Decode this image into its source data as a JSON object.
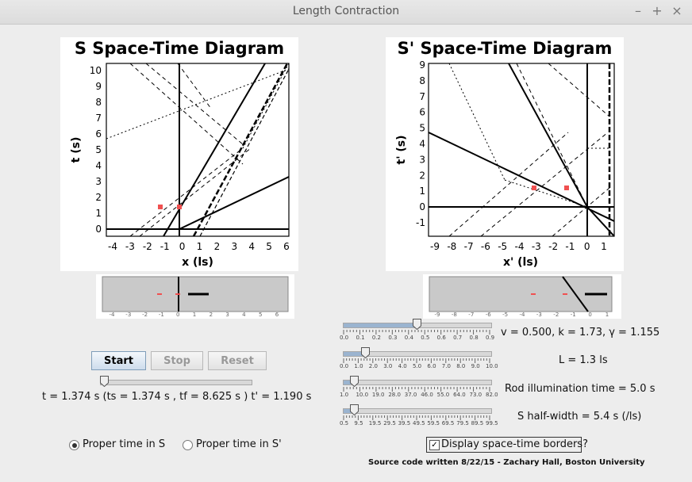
{
  "window": {
    "title": "Length Contraction",
    "controls": [
      "–",
      "+",
      "×"
    ]
  },
  "s_diagram": {
    "title": "S Space-Time Diagram",
    "xlabel": "x (ls)",
    "ylabel": "t (s)",
    "xticks": [
      "-4",
      "-3",
      "-2",
      "-1",
      "0",
      "1",
      "2",
      "3",
      "4",
      "5",
      "6"
    ],
    "yticks": [
      "0",
      "1",
      "2",
      "3",
      "4",
      "5",
      "6",
      "7",
      "8",
      "9",
      "10"
    ]
  },
  "sp_diagram": {
    "title": "S' Space-Time Diagram",
    "xlabel": "x' (ls)",
    "ylabel": "t' (s)",
    "xticks": [
      "-9",
      "-8",
      "-7",
      "-6",
      "-5",
      "-4",
      "-3",
      "-2",
      "-1",
      "0",
      "1"
    ],
    "yticks": [
      "-1",
      "0",
      "1",
      "2",
      "3",
      "4",
      "5",
      "6",
      "7",
      "8",
      "9"
    ]
  },
  "strip_s": {
    "ticks": [
      "-4",
      "-3",
      "-2",
      "-1",
      "0",
      "1",
      "2",
      "3",
      "4",
      "5",
      "6"
    ]
  },
  "strip_sp": {
    "ticks": [
      "-9",
      "-8",
      "-7",
      "-6",
      "-5",
      "-4",
      "-3",
      "-2",
      "-1",
      "0",
      "1"
    ]
  },
  "buttons": {
    "start": "Start",
    "stop": "Stop",
    "reset": "Reset"
  },
  "time_readout": "t = 1.374 s (ts = 1.374 s , tf = 8.625 s ) t' = 1.190 s",
  "time_slider": {
    "value": 0.0
  },
  "radios": {
    "proper_s": "Proper time in S",
    "proper_sp": "Proper time in S'",
    "selected": "proper_s"
  },
  "sliders": [
    {
      "id": "velocity",
      "ticks": [
        "0.0",
        "0.1",
        "0.2",
        "0.3",
        "0.4",
        "0.5",
        "0.6",
        "0.7",
        "0.8",
        "0.9"
      ],
      "value": 0.5
    },
    {
      "id": "length",
      "ticks": [
        "0.0",
        "1.0",
        "2.0",
        "3.0",
        "4.0",
        "5.0",
        "6.0",
        "7.0",
        "8.0",
        "9.0",
        "10.0"
      ],
      "value": 0.13
    },
    {
      "id": "illumination",
      "ticks": [
        "1.0",
        "10.0",
        "19.0",
        "28.0",
        "37.0",
        "46.0",
        "55.0",
        "64.0",
        "73.0",
        "82.0"
      ],
      "value": 0.05
    },
    {
      "id": "halfwidth",
      "ticks": [
        "0.5",
        "9.5",
        "19.5",
        "29.5",
        "39.5",
        "49.5",
        "59.5",
        "69.5",
        "79.5",
        "89.5",
        "99.5"
      ],
      "value": 0.05
    }
  ],
  "readouts": {
    "vkg": "v =  0.500, k =  1.73, γ =  1.155",
    "length": "L = 1.3 ls",
    "illumination": "Rod illumination time = 5.0 s",
    "halfwidth": "S half-width = 5.4 s (/ls)"
  },
  "checkbox": {
    "label": "Display space-time borders?",
    "checked": true
  },
  "footer": "Source code written 8/22/15 - Zachary Hall, Boston University"
}
